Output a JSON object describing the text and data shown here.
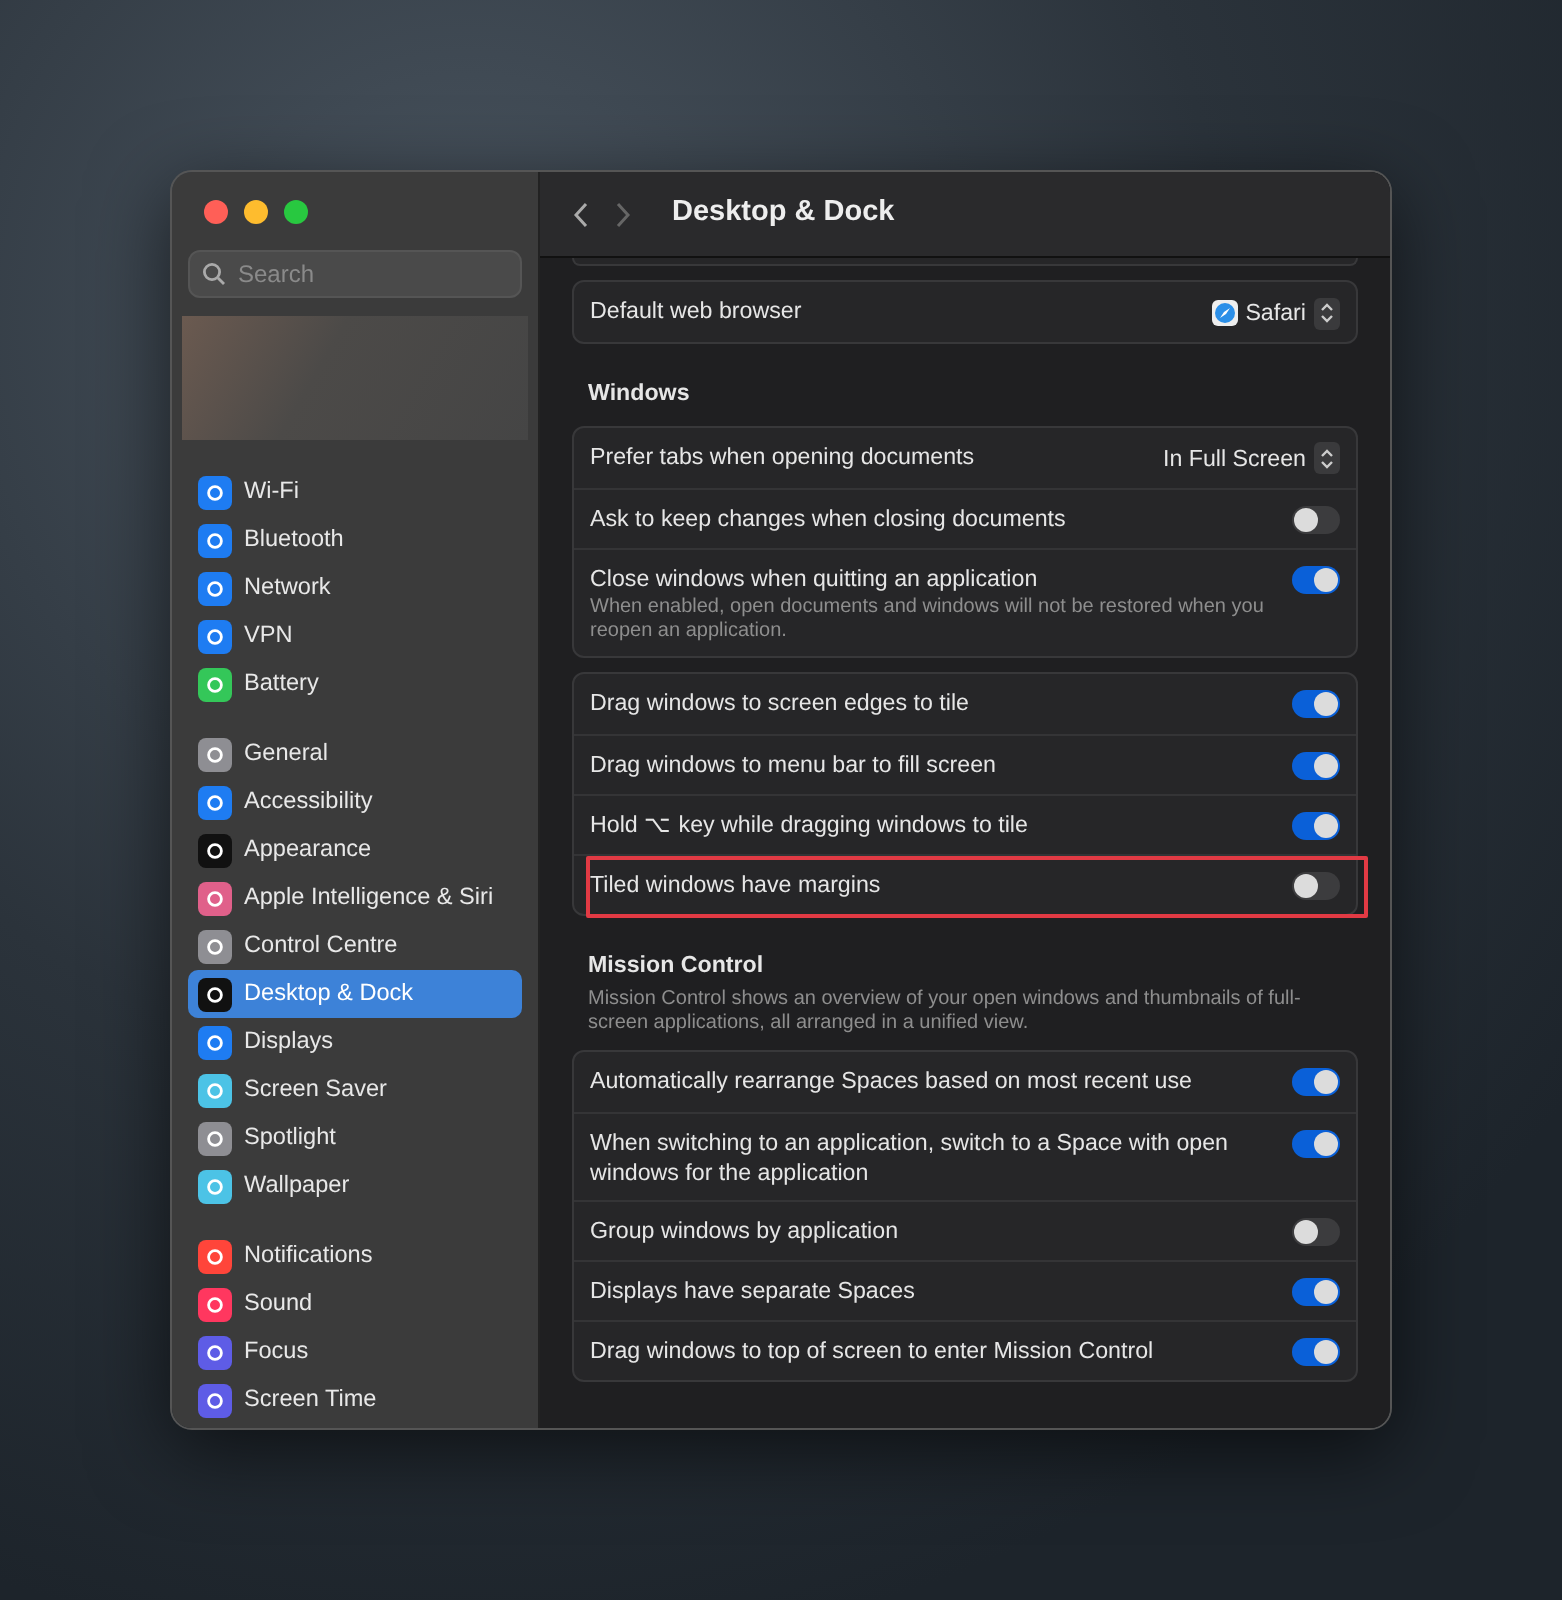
{
  "window": {
    "title": "Desktop & Dock"
  },
  "search": {
    "placeholder": "Search"
  },
  "sidebar": {
    "groups": [
      {
        "items": [
          {
            "label": "Wi-Fi",
            "color": "#1e7cf2",
            "selected": false
          },
          {
            "label": "Bluetooth",
            "color": "#1e7cf2",
            "selected": false
          },
          {
            "label": "Network",
            "color": "#1e7cf2",
            "selected": false
          },
          {
            "label": "VPN",
            "color": "#1e7cf2",
            "selected": false
          },
          {
            "label": "Battery",
            "color": "#34c759",
            "selected": false
          }
        ]
      },
      {
        "items": [
          {
            "label": "General",
            "color": "#8e8e93",
            "selected": false
          },
          {
            "label": "Accessibility",
            "color": "#1e7cf2",
            "selected": false
          },
          {
            "label": "Appearance",
            "color": "#111111",
            "selected": false
          },
          {
            "label": "Apple Intelligence & Siri",
            "color": "#e0608a",
            "selected": false
          },
          {
            "label": "Control Centre",
            "color": "#8e8e93",
            "selected": false
          },
          {
            "label": "Desktop & Dock",
            "color": "#111111",
            "selected": true
          },
          {
            "label": "Displays",
            "color": "#1e7cf2",
            "selected": false
          },
          {
            "label": "Screen Saver",
            "color": "#4cc3e6",
            "selected": false
          },
          {
            "label": "Spotlight",
            "color": "#8e8e93",
            "selected": false
          },
          {
            "label": "Wallpaper",
            "color": "#4cc3e6",
            "selected": false
          }
        ]
      },
      {
        "items": [
          {
            "label": "Notifications",
            "color": "#ff453a",
            "selected": false
          },
          {
            "label": "Sound",
            "color": "#ff375f",
            "selected": false
          },
          {
            "label": "Focus",
            "color": "#5e5ce6",
            "selected": false
          },
          {
            "label": "Screen Time",
            "color": "#5e5ce6",
            "selected": false
          }
        ]
      }
    ]
  },
  "sections": [
    {
      "cards": [
        [
          {
            "kind": "popup",
            "label": "Default web browser",
            "value": "Safari",
            "app_icon": true
          }
        ]
      ]
    },
    {
      "title": "Windows",
      "cards": [
        [
          {
            "kind": "popup",
            "label": "Prefer tabs when opening documents",
            "value": "In Full Screen"
          },
          {
            "kind": "toggle",
            "label": "Ask to keep changes when closing documents",
            "on": false
          },
          {
            "kind": "toggle",
            "label": "Close windows when quitting an application",
            "description": "When enabled, open documents and windows will not be restored when you reopen an application.",
            "on": true
          }
        ],
        [
          {
            "kind": "toggle",
            "label": "Drag windows to screen edges to tile",
            "on": true
          },
          {
            "kind": "toggle",
            "label": "Drag windows to menu bar to fill screen",
            "on": true
          },
          {
            "kind": "toggle",
            "label": "Hold ⌥ key while dragging windows to tile",
            "on": true
          },
          {
            "kind": "toggle",
            "label": "Tiled windows have margins",
            "on": false,
            "highlighted": true
          }
        ]
      ]
    },
    {
      "title": "Mission Control",
      "description": "Mission Control shows an overview of your open windows and thumbnails of full-screen applications, all arranged in a unified view.",
      "cards": [
        [
          {
            "kind": "toggle",
            "label": "Automatically rearrange Spaces based on most recent use",
            "on": true
          },
          {
            "kind": "toggle",
            "label": "When switching to an application, switch to a Space with open windows for the application",
            "on": true
          },
          {
            "kind": "toggle",
            "label": "Group windows by application",
            "on": false
          },
          {
            "kind": "toggle",
            "label": "Displays have separate Spaces",
            "on": true
          },
          {
            "kind": "toggle",
            "label": "Drag windows to top of screen to enter Mission Control",
            "on": true
          }
        ]
      ]
    }
  ]
}
